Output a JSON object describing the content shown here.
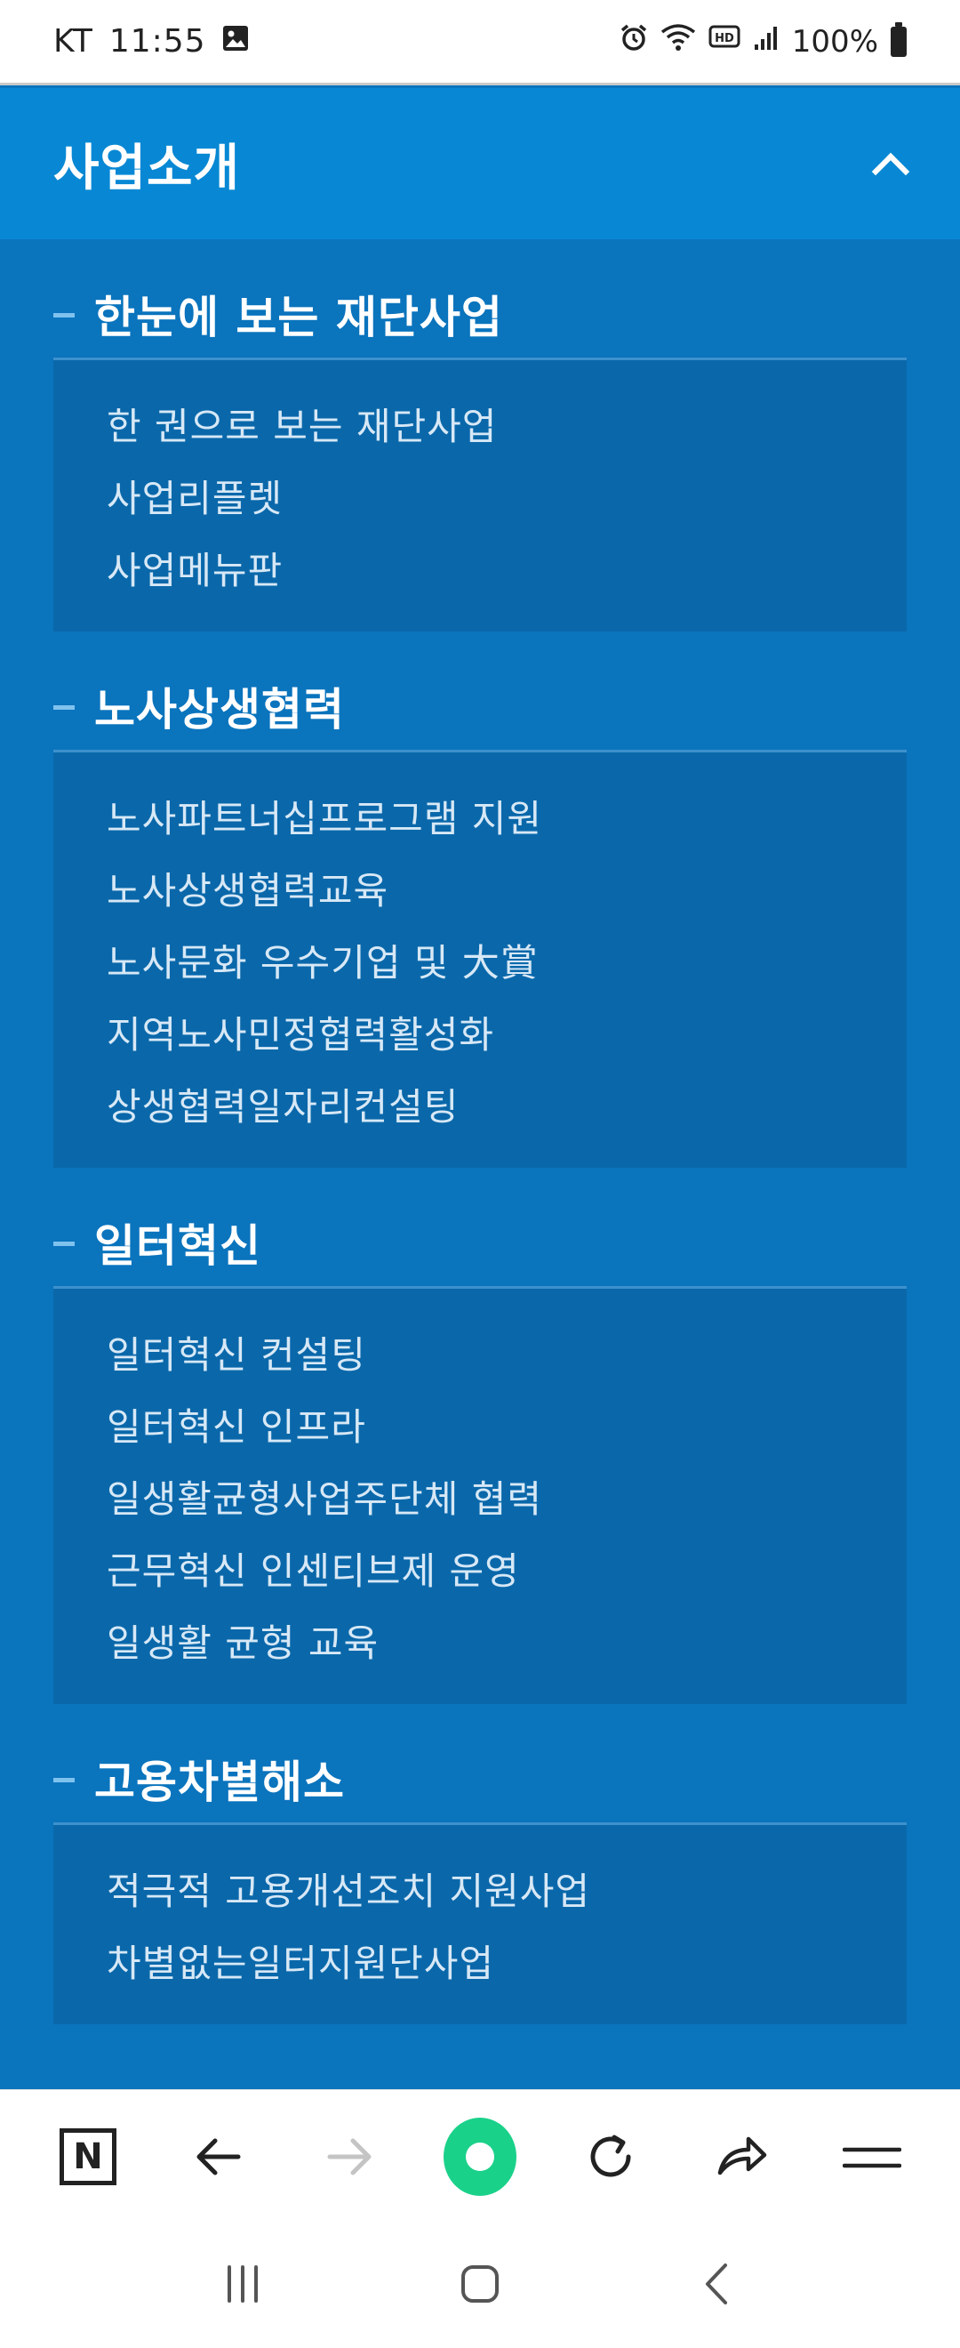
{
  "status_bar": {
    "carrier": "KT",
    "time": "11:55",
    "battery": "100%"
  },
  "header": {
    "title": "사업소개",
    "toggle_icon": "chevron-up-icon"
  },
  "sections": [
    {
      "title": "한눈에 보는 재단사업",
      "items": [
        "한 권으로 보는 재단사업",
        "사업리플렛",
        "사업메뉴판"
      ]
    },
    {
      "title": "노사상생협력",
      "items": [
        "노사파트너십프로그램 지원",
        "노사상생협력교육",
        "노사문화 우수기업 및 大賞",
        "지역노사민정협력활성화",
        "상생협력일자리컨설팅"
      ]
    },
    {
      "title": "일터혁신",
      "items": [
        "일터혁신 컨설팅",
        "일터혁신 인프라",
        "일생활균형사업주단체 협력",
        "근무혁신 인센티브제 운영",
        "일생활 균형 교육"
      ]
    },
    {
      "title": "고용차별해소",
      "items": [
        "적극적 고용개선조치 지원사업",
        "차별없는일터지원단사업"
      ]
    }
  ],
  "toolbar": {
    "n_label": "N",
    "icons": [
      "naver-n-icon",
      "back-arrow-icon",
      "forward-arrow-icon",
      "home-dot-icon",
      "refresh-icon",
      "share-icon",
      "menu-icon"
    ]
  },
  "colors": {
    "header_bg": "#0888d4",
    "content_bg": "#0a74bd",
    "sublist_bg": "#0a68aa",
    "accent_green": "#1ad18a"
  }
}
